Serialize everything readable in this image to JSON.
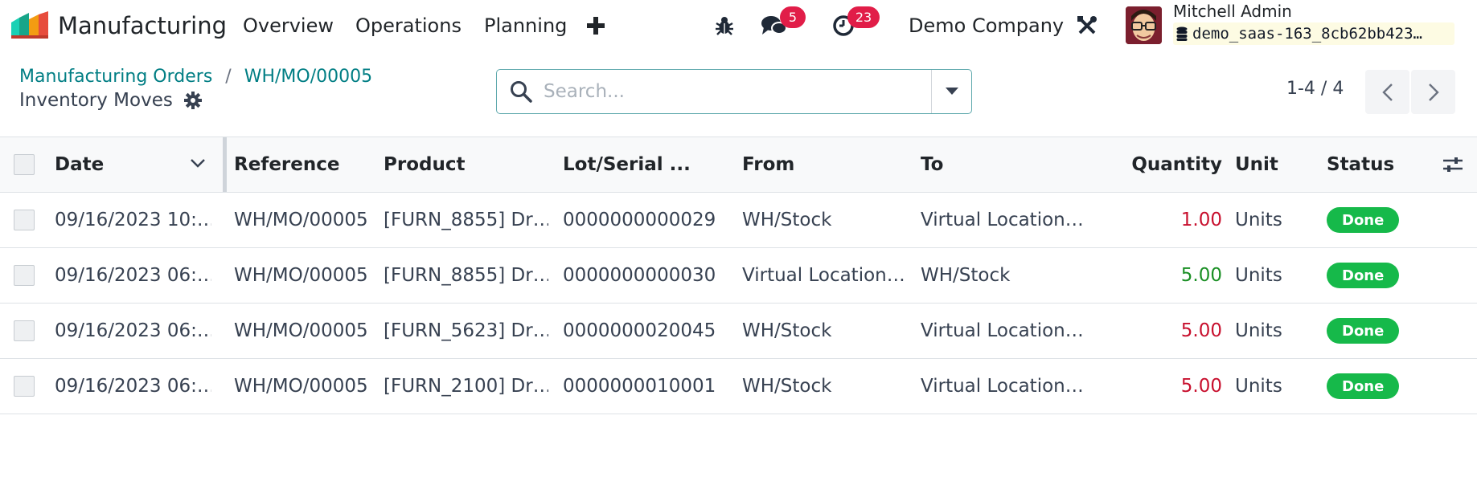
{
  "navbar": {
    "app_name": "Manufacturing",
    "menu": [
      "Overview",
      "Operations",
      "Planning"
    ],
    "new_icon": "plus-icon",
    "messages_count": "5",
    "activities_count": "23",
    "company": "Demo Company",
    "user_name": "Mitchell Admin",
    "database": "demo_saas-163_8cb62bb423…"
  },
  "breadcrumb": {
    "parent": "Manufacturing Orders",
    "separator": "/",
    "current": "WH/MO/00005"
  },
  "page_title": "Inventory Moves",
  "search": {
    "placeholder": "Search..."
  },
  "pager": {
    "value": "1-4 / 4"
  },
  "table": {
    "columns": {
      "date": "Date",
      "reference": "Reference",
      "product": "Product",
      "lot": "Lot/Serial ...",
      "from": "From",
      "to": "To",
      "quantity": "Quantity",
      "unit": "Unit",
      "status": "Status"
    },
    "rows": [
      {
        "date": "09/16/2023 10:…",
        "reference": "WH/MO/00005",
        "product": "[FURN_8855] Dr…",
        "lot": "0000000000029",
        "from": "WH/Stock",
        "to": "Virtual Location…",
        "quantity": "1.00",
        "unit": "Units",
        "status": "Done"
      },
      {
        "date": "09/16/2023 06:…",
        "reference": "WH/MO/00005",
        "product": "[FURN_8855] Dr…",
        "lot": "0000000000030",
        "from": "Virtual Location…",
        "to": "WH/Stock",
        "quantity": "5.00",
        "unit": "Units",
        "status": "Done"
      },
      {
        "date": "09/16/2023 06:…",
        "reference": "WH/MO/00005",
        "product": "[FURN_5623] Dr…",
        "lot": "0000000020045",
        "from": "WH/Stock",
        "to": "Virtual Location…",
        "quantity": "5.00",
        "unit": "Units",
        "status": "Done"
      },
      {
        "date": "09/16/2023 06:…",
        "reference": "WH/MO/00005",
        "product": "[FURN_2100] Dr…",
        "lot": "0000000010001",
        "from": "WH/Stock",
        "to": "Virtual Location…",
        "quantity": "5.00",
        "unit": "Units",
        "status": "Done"
      }
    ]
  },
  "colors": {
    "brand": "#017e84",
    "badge": "#e11d48",
    "status_done": "#16b94a",
    "qty_out": "#c8102e",
    "qty_in": "#1a8f24"
  }
}
